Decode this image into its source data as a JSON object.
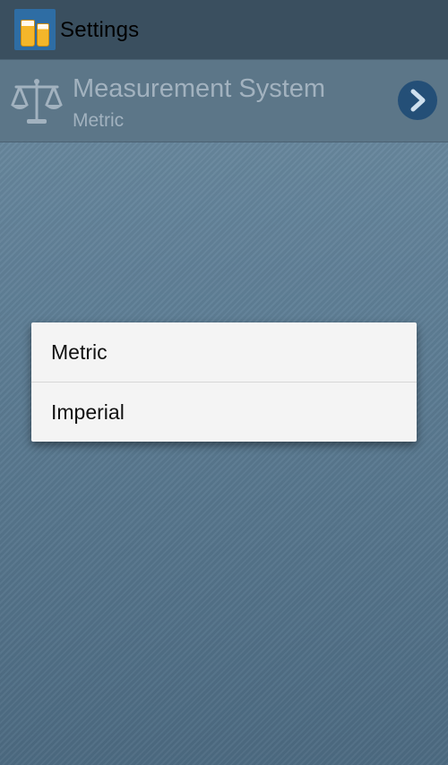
{
  "action_bar": {
    "title": "Settings",
    "app_icon": "beer-mugs-icon"
  },
  "preference": {
    "icon": "scale-icon",
    "title": "Measurement System",
    "summary": "Metric",
    "action_icon": "chevron-right-icon"
  },
  "dialog": {
    "options": [
      {
        "label": "Metric"
      },
      {
        "label": "Imperial"
      }
    ]
  },
  "colors": {
    "action_bar_bg": "#3a4f5f",
    "pref_row_bg": "#5c7688",
    "pref_text": "#a2b2bf",
    "chevron_bg": "#244f77",
    "dialog_bg": "#f4f4f4",
    "background_top": "#6f8ea3",
    "background_bottom": "#4d6b82"
  }
}
